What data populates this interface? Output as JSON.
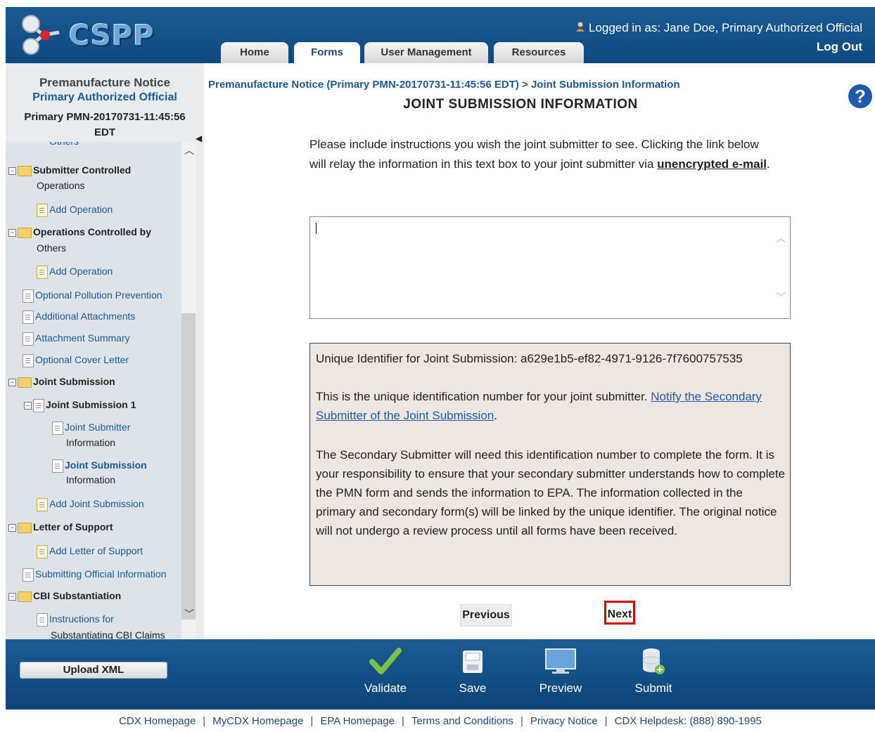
{
  "header": {
    "logo_text": "CSPP",
    "logged_in": "Logged in as: Jane Doe, Primary Authorized Official",
    "logout": "Log Out",
    "tabs": [
      {
        "label": "Home"
      },
      {
        "label": "Forms"
      },
      {
        "label": "User Management"
      },
      {
        "label": "Resources"
      }
    ]
  },
  "sidebar": {
    "title": "Premanufacture Notice",
    "subtitle": "Primary Authorized Official",
    "pmn_id_line1": "Primary PMN-20170731-11:45:56",
    "pmn_id_line2": "EDT",
    "items": [
      {
        "label": "Others"
      },
      {
        "label_line1": "Submitter Controlled",
        "label_line2": "Operations"
      },
      {
        "label": "Add Operation"
      },
      {
        "label_line1": "Operations Controlled by",
        "label_line2": "Others"
      },
      {
        "label": "Add Operation"
      },
      {
        "label": "Optional Pollution Prevention"
      },
      {
        "label": "Additional Attachments"
      },
      {
        "label": "Attachment Summary"
      },
      {
        "label": "Optional Cover Letter"
      },
      {
        "label": "Joint Submission"
      },
      {
        "label": "Joint Submission 1"
      },
      {
        "label_line1": "Joint Submitter",
        "label_line2": "Information"
      },
      {
        "label_line1": "Joint Submission",
        "label_line2": "Information"
      },
      {
        "label": "Add Joint Submission"
      },
      {
        "label": "Letter of Support"
      },
      {
        "label": "Add Letter of Support"
      },
      {
        "label": "Submitting Official Information"
      },
      {
        "label": "CBI Substantiation"
      },
      {
        "label_line1": "Instructions for",
        "label_line2": "Substantiating CBI Claims"
      }
    ]
  },
  "main": {
    "breadcrumb": "Premanufacture Notice (Primary PMN-20170731-11:45:56 EDT) > Joint Submission Information",
    "title": "JOINT SUBMISSION INFORMATION",
    "instructions_text": "Please include instructions you wish the joint submitter to see. Clicking the link below will relay the information in this text box to your joint submitter via ",
    "instructions_link": "unencrypted e-mail",
    "instructions_end": ".",
    "textbox_value": "",
    "info": {
      "unique_id": "Unique Identifier for Joint Submission: a629e1b5-ef82-4971-9126-7f7600757535",
      "para2_text": "This is the unique identification number for your joint submitter. ",
      "para2_link": "Notify the Secondary Submitter of the Joint Submission",
      "para2_end": ".",
      "para3": "The Secondary Submitter will need this identification number to complete the form. It is your responsibility to ensure that your secondary submitter understands how to complete the PMN form and sends the information to EPA. The information collected in the primary and secondary form(s) will be linked by the unique identifier. The original notice will not undergo a review process until all forms have been received."
    },
    "previous_label": "Previous",
    "next_label": "Next"
  },
  "toolbar": {
    "upload_label": "Upload XML",
    "validate_label": "Validate",
    "save_label": "Save",
    "preview_label": "Preview",
    "submit_label": "Submit"
  },
  "footer_links": [
    {
      "label": "CDX Homepage"
    },
    {
      "label": "MyCDX Homepage"
    },
    {
      "label": "EPA Homepage"
    },
    {
      "label": "Terms and Conditions"
    },
    {
      "label": "Privacy Notice"
    },
    {
      "label": "CDX Helpdesk: (888) 890-1995"
    }
  ],
  "colors": {
    "header_blue": "#1a5a93",
    "link_blue": "#1d5ab0",
    "info_bg": "#ede6e1",
    "next_highlight": "#d40000"
  }
}
